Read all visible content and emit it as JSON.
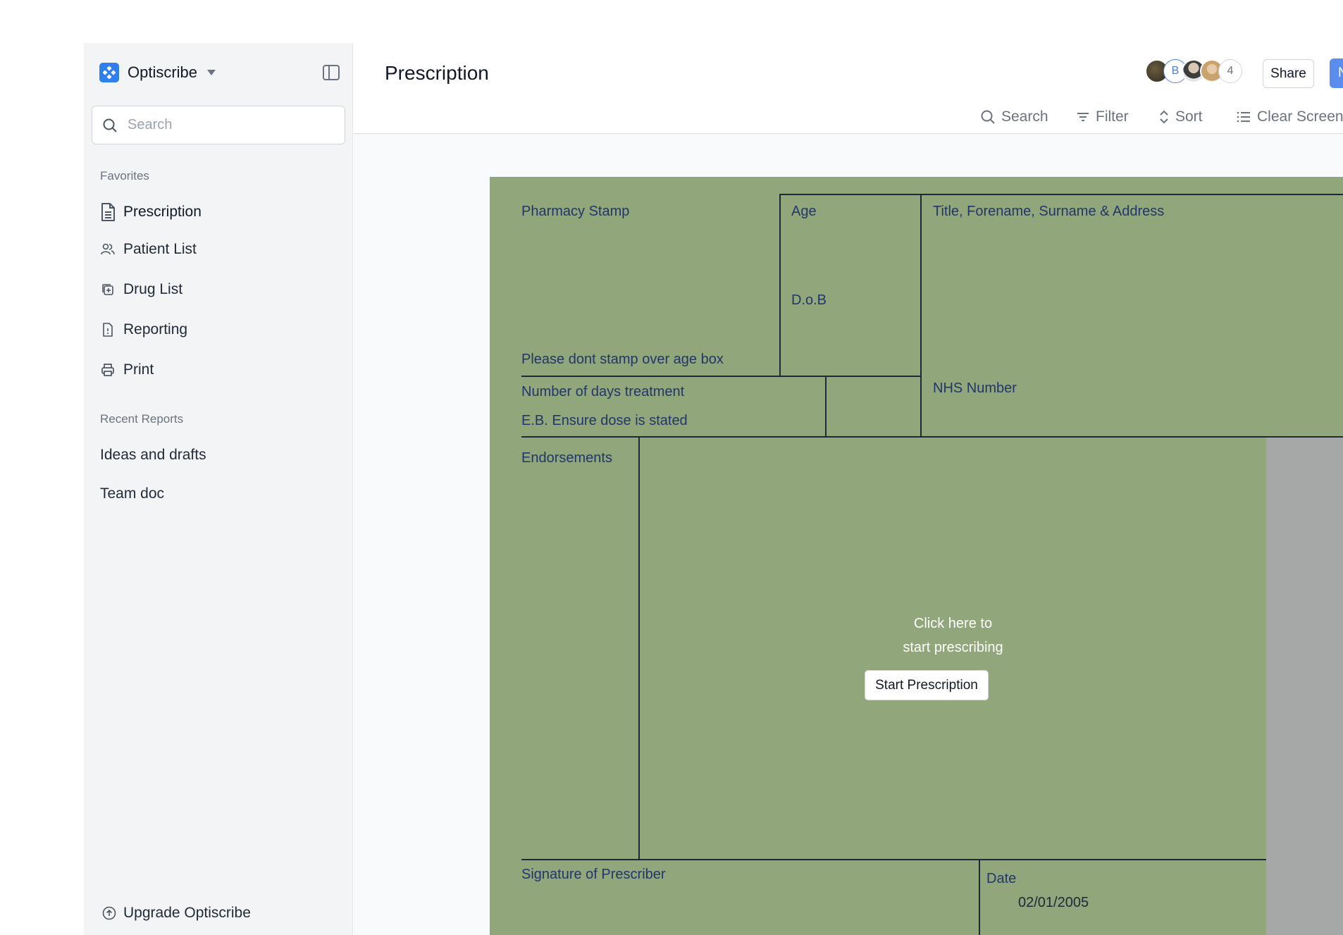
{
  "app": {
    "name": "Optiscribe",
    "brand_color": "#2f80ed"
  },
  "sidebar": {
    "search_placeholder": "Search",
    "favorites_label": "Favorites",
    "favorites": [
      {
        "label": "Prescription",
        "icon": "document-icon"
      },
      {
        "label": "Patient List",
        "icon": "users-icon"
      },
      {
        "label": "Drug List",
        "icon": "drug-icon"
      },
      {
        "label": "Reporting",
        "icon": "report-icon"
      },
      {
        "label": "Print",
        "icon": "printer-icon"
      }
    ],
    "recent_label": "Recent Reports",
    "recent": [
      {
        "label": "Ideas and drafts"
      },
      {
        "label": "Team doc"
      }
    ],
    "upgrade_label": "Upgrade Optiscribe"
  },
  "header": {
    "title": "Prescription",
    "avatar_initial": "B",
    "collaborator_count": "4",
    "share_label": "Share",
    "new_label": "N"
  },
  "toolbar": {
    "search": "Search",
    "filter": "Filter",
    "sort": "Sort",
    "clear": "Clear Screen"
  },
  "form": {
    "pharmacy_stamp": "Pharmacy Stamp",
    "age": "Age",
    "dob": "D.o.B",
    "patient_details": "Title, Forename, Surname & Address",
    "stamp_note": "Please dont stamp over age box",
    "days_treatment": "Number of days treatment",
    "dose_note": "E.B. Ensure dose is stated",
    "nhs_number": "NHS Number",
    "endorsements": "Endorsements",
    "cta_line1": "Click here to",
    "cta_line2": "start prescribing",
    "start_button": "Start Prescription",
    "signature": "Signature of Prescriber",
    "date_label": "Date",
    "date_value": "02/01/2005",
    "background_color": "#91a67a",
    "label_color": "#23366b"
  }
}
